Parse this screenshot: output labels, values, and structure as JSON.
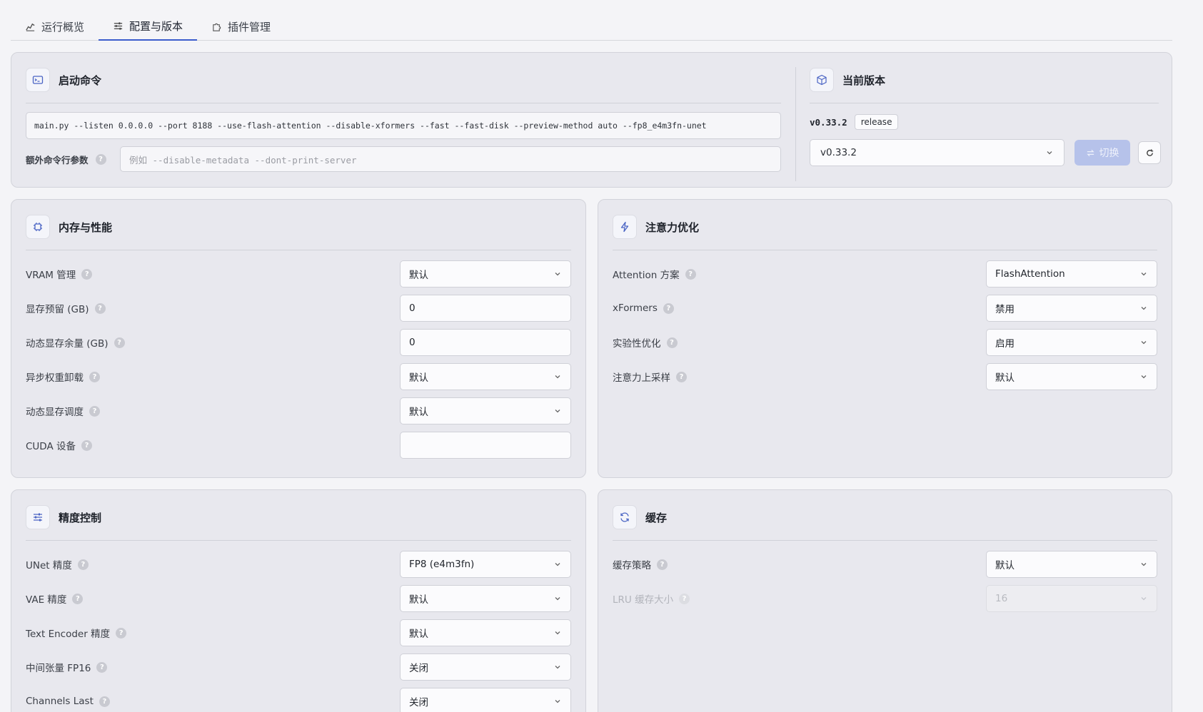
{
  "tabs": [
    {
      "label": "运行概览",
      "icon": "chart-icon",
      "active": false
    },
    {
      "label": "配置与版本",
      "icon": "sliders-icon",
      "active": true
    },
    {
      "label": "插件管理",
      "icon": "puzzle-icon",
      "active": false
    }
  ],
  "launch": {
    "title": "启动命令",
    "command": "main.py --listen 0.0.0.0 --port 8188 --use-flash-attention --disable-xformers --fast --fast-disk --preview-method auto --fp8_e4m3fn-unet",
    "extra_label": "额外命令行参数",
    "extra_placeholder": "例如 --disable-metadata --dont-print-server"
  },
  "version": {
    "title": "当前版本",
    "current": "v0.33.2",
    "channel": "release",
    "selected": "v0.33.2",
    "switch_label": "切换"
  },
  "memory": {
    "title": "内存与性能",
    "rows": [
      {
        "label": "VRAM 管理",
        "value": "默认",
        "kind": "select"
      },
      {
        "label": "显存预留 (GB)",
        "value": "0",
        "kind": "input"
      },
      {
        "label": "动态显存余量 (GB)",
        "value": "0",
        "kind": "input"
      },
      {
        "label": "异步权重卸载",
        "value": "默认",
        "kind": "select"
      },
      {
        "label": "动态显存调度",
        "value": "默认",
        "kind": "select"
      },
      {
        "label": "CUDA 设备",
        "value": "",
        "kind": "input"
      }
    ]
  },
  "attention": {
    "title": "注意力优化",
    "rows": [
      {
        "label": "Attention 方案",
        "value": "FlashAttention",
        "kind": "select"
      },
      {
        "label": "xFormers",
        "value": "禁用",
        "kind": "select"
      },
      {
        "label": "实验性优化",
        "value": "启用",
        "kind": "select"
      },
      {
        "label": "注意力上采样",
        "value": "默认",
        "kind": "select"
      }
    ]
  },
  "precision": {
    "title": "精度控制",
    "rows": [
      {
        "label": "UNet 精度",
        "value": "FP8 (e4m3fn)",
        "kind": "select"
      },
      {
        "label": "VAE 精度",
        "value": "默认",
        "kind": "select"
      },
      {
        "label": "Text Encoder 精度",
        "value": "默认",
        "kind": "select"
      },
      {
        "label": "中间张量 FP16",
        "value": "关闭",
        "kind": "select"
      },
      {
        "label": "Channels Last",
        "value": "关闭",
        "kind": "select"
      }
    ]
  },
  "cache": {
    "title": "缓存",
    "rows": [
      {
        "label": "缓存策略",
        "value": "默认",
        "kind": "select"
      },
      {
        "label": "LRU 缓存大小",
        "value": "16",
        "kind": "select",
        "disabled": true
      }
    ]
  },
  "help_glyph": "?",
  "colors": {
    "accent": "#3b5ccc",
    "card": "#e8e8ee",
    "switch_disabled": "#b6c2ea"
  }
}
